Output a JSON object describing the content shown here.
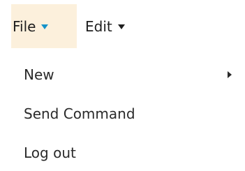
{
  "menubar": {
    "items": [
      {
        "label": "File",
        "caret_icon": "caret-down-icon",
        "caret_color": "#1593c9",
        "active_bg": "#fcf0dc"
      },
      {
        "label": "Edit",
        "caret_icon": "caret-down-icon",
        "caret_color": "#1f1f1f"
      }
    ]
  },
  "dropdown": {
    "items": [
      {
        "label": "New",
        "submenu_icon": "chevron-right-icon"
      },
      {
        "label": "Send Command"
      },
      {
        "label": "Log out"
      }
    ]
  }
}
